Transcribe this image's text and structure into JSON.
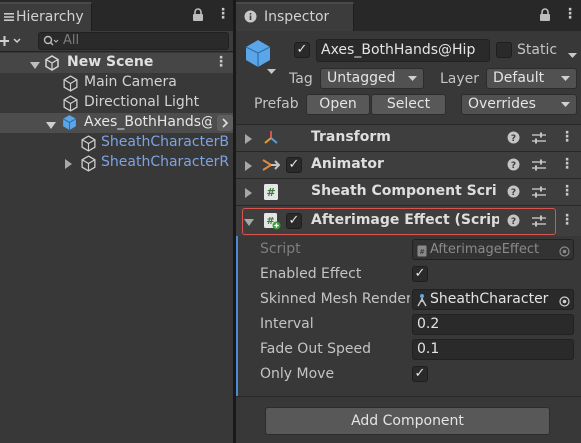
{
  "hierarchy": {
    "tab_label": "Hierarchy",
    "search_placeholder": "All",
    "scene_name": "New Scene",
    "items": [
      {
        "label": "Main Camera"
      },
      {
        "label": "Directional Light"
      },
      {
        "label": "Axes_BothHands@"
      },
      {
        "label": "SheathCharacterB"
      },
      {
        "label": "SheathCharacterR"
      }
    ]
  },
  "inspector": {
    "tab_label": "Inspector",
    "object_name": "Axes_BothHands@Hip",
    "static_label": "Static",
    "tag_label": "Tag",
    "tag_value": "Untagged",
    "layer_label": "Layer",
    "layer_value": "Default",
    "prefab_label": "Prefab",
    "open_label": "Open",
    "select_label": "Select",
    "overrides_label": "Overrides",
    "components": [
      {
        "title": "Transform"
      },
      {
        "title": "Animator"
      },
      {
        "title": "Sheath Component Script"
      },
      {
        "title": "Afterimage Effect (Script)"
      }
    ],
    "properties": {
      "script_label": "Script",
      "script_value": "AfterimageEffect",
      "enabled_effect_label": "Enabled Effect",
      "skinned_mesh_label": "Skinned Mesh Renderer",
      "skinned_mesh_value": "SheathCharacter",
      "interval_label": "Interval",
      "interval_value": "0.2",
      "fade_out_label": "Fade Out Speed",
      "fade_out_value": "0.1",
      "only_move_label": "Only Move"
    },
    "add_component_label": "Add Component"
  },
  "colors": {
    "highlight_border": "#d9534f",
    "prefab_blue": "#7da3e0",
    "selection_row": "#4d4d4d"
  }
}
